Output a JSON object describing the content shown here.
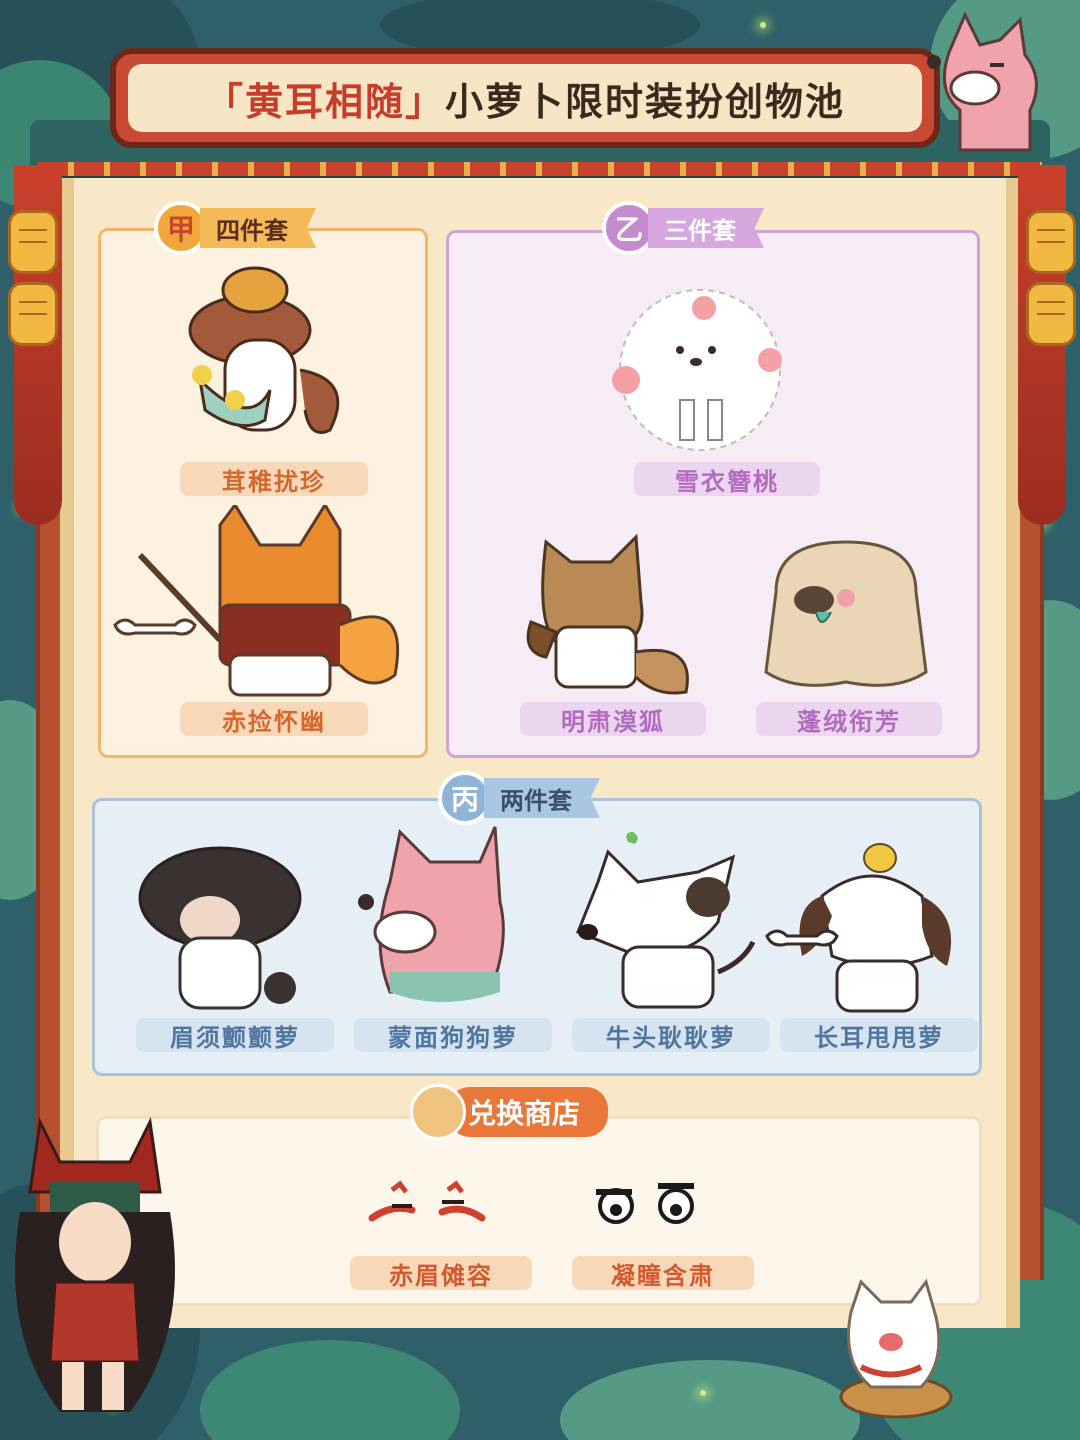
{
  "title": {
    "prefix": "「黄耳相随」",
    "suffix": "小萝卜限时装扮创物池"
  },
  "sections": {
    "jia": {
      "badge": "甲",
      "name": "四件套",
      "items": [
        "茸稚扰珍",
        "赤捡怀幽"
      ]
    },
    "yi": {
      "badge": "乙",
      "name": "三件套",
      "items": [
        "雪衣簪桃",
        "明肃漠狐",
        "蓬绒衔芳"
      ]
    },
    "bing": {
      "badge": "丙",
      "name": "两件套",
      "items": [
        "眉须颤颤萝",
        "蒙面狗狗萝",
        "牛头耿耿萝",
        "长耳甩甩萝"
      ]
    },
    "shop": {
      "name": "兑换商店",
      "items": [
        "赤眉傩容",
        "凝瞳含肃"
      ]
    }
  },
  "colors": {
    "jia_accent": "#f2a73c",
    "yi_accent": "#c58bcf",
    "bing_accent": "#8fb4d6",
    "shop_accent": "#e9773a",
    "title_red": "#c83c2a"
  }
}
